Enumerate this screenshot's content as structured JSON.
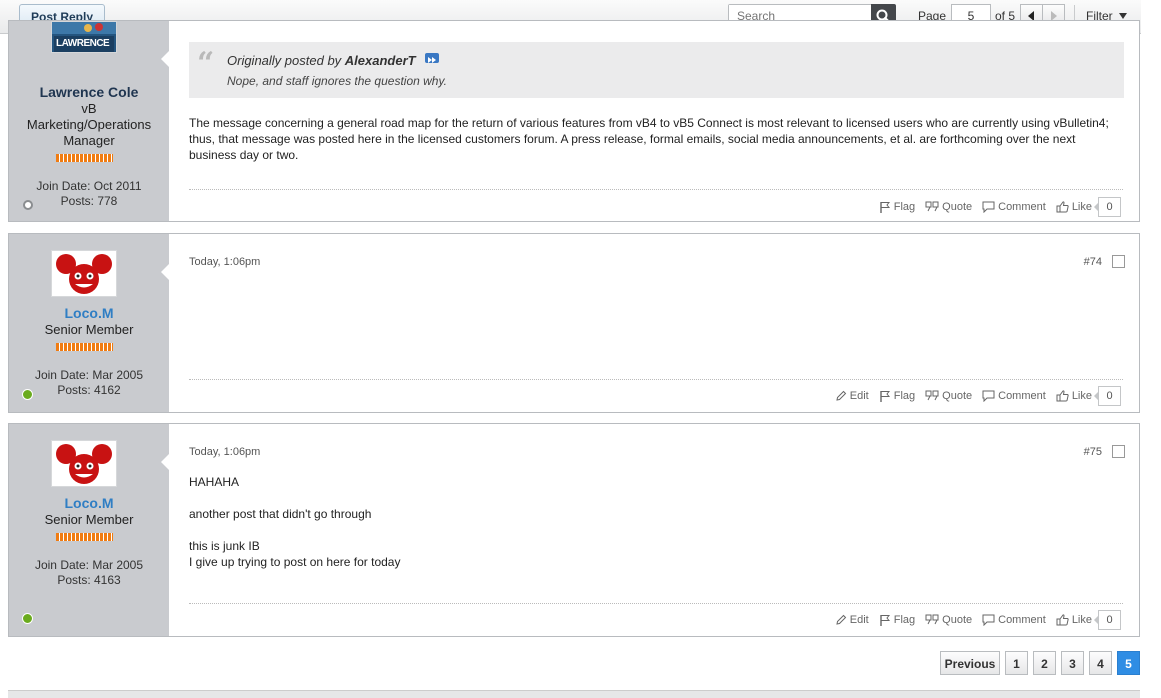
{
  "toolbar": {
    "post_reply_label": "Post Reply",
    "search_placeholder": "Search",
    "page_label": "Page",
    "page_value": "5",
    "of_label": "of 5",
    "filter_label": "Filter"
  },
  "posts": [
    {
      "username": "Lawrence Cole",
      "username_color": "#1f3550",
      "title_lines": [
        "vB",
        "Marketing/Operations",
        "Manager"
      ],
      "join_date": "Join Date: Oct 2011",
      "posts_count": "Posts: 778",
      "status": "offline",
      "avatar_text": "LAWRENCE",
      "quote": {
        "prefix": "Originally posted by",
        "author": "AlexanderT",
        "text": "Nope, and staff ignores the question why."
      },
      "body": "The message concerning a general road map for the return of various features from vB4 to vB5 Connect is most relevant to licensed users who are currently using vBulletin4; thus, that message was posted here in the licensed customers forum. A press release, formal emails, social media announcements, et al. are forthcoming over the next business day or two.",
      "actions": {
        "flag": "Flag",
        "quote": "Quote",
        "comment": "Comment",
        "like": "Like",
        "like_count": "0"
      }
    },
    {
      "username": "Loco.M",
      "username_color": "#2f7ec4",
      "title": "Senior Member",
      "join_date": "Join Date: Mar 2005",
      "posts_count": "Posts: 4162",
      "status": "online",
      "date": "Today, 1:06pm",
      "number": "#74",
      "body_lines": [],
      "actions": {
        "edit": "Edit",
        "flag": "Flag",
        "quote": "Quote",
        "comment": "Comment",
        "like": "Like",
        "like_count": "0"
      }
    },
    {
      "username": "Loco.M",
      "username_color": "#2f7ec4",
      "title": "Senior Member",
      "join_date": "Join Date: Mar 2005",
      "posts_count": "Posts: 4163",
      "status": "online",
      "date": "Today, 1:06pm",
      "number": "#75",
      "body_lines": [
        "HAHAHA",
        "another post that didn't go through",
        "this is junk IB",
        "I give up trying to post on here for today"
      ],
      "actions": {
        "edit": "Edit",
        "flag": "Flag",
        "quote": "Quote",
        "comment": "Comment",
        "like": "Like",
        "like_count": "0"
      }
    }
  ],
  "pagination": {
    "previous_label": "Previous",
    "pages": [
      "1",
      "2",
      "3",
      "4",
      "5"
    ],
    "current": "5"
  },
  "colors": {
    "online": "#6aab1e",
    "offline": "#8a8d90",
    "accent": "#2f8de4"
  }
}
